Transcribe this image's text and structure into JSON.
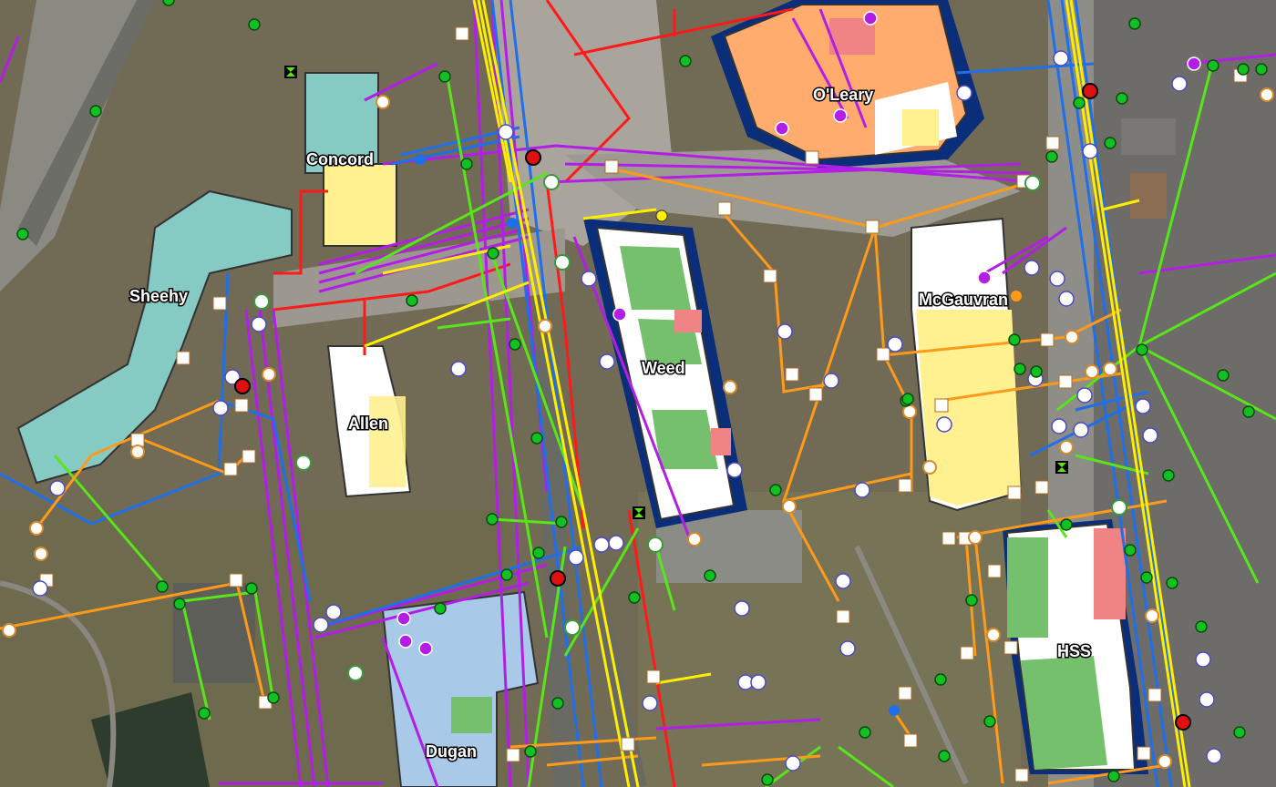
{
  "map": {
    "building_labels": {
      "oleary": "O'Leary",
      "concord": "Concord",
      "sheehy": "Sheehy",
      "weed": "Weed",
      "mcgauvran": "McGauvran",
      "allen": "Allen",
      "hss": "HSS",
      "dugan": "Dugan"
    },
    "utility_colors": {
      "red": "#ff1a1a",
      "purple": "#b31ee6",
      "blue": "#1f6fe8",
      "green": "#58e51a",
      "orange": "#ff9a1a",
      "yellow": "#ffee00"
    },
    "marker_icons": [
      "manhole-square-icon",
      "valve-circle-icon",
      "hydrant-icon",
      "crossed-circle-icon",
      "green-dot-icon",
      "electric-e-icon",
      "transformer-icon"
    ]
  }
}
